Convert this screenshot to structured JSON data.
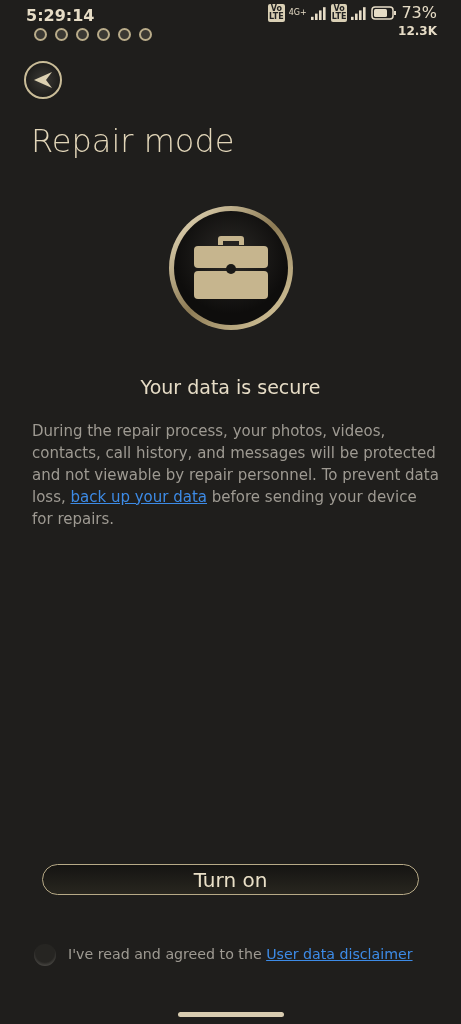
{
  "status_bar": {
    "time": "5:29:14",
    "network_label": "4G+",
    "volte_badges": [
      "Vo\nLTE",
      "Vo\nLTE"
    ],
    "battery_percent": "73%",
    "speed": "12.3K"
  },
  "title": "Repair mode",
  "heading": "Your data is secure",
  "description": {
    "text_before": "During the repair process, your photos, videos, contacts, call history, and messages will be protected and not viewable by repair personnel. To prevent data loss, ",
    "link": "back up your data",
    "text_after": " before sending your device for repairs."
  },
  "button": "Turn on",
  "agreement": {
    "checked": false,
    "text": "I've read and agreed to the",
    "link": "User data disclaimer"
  }
}
